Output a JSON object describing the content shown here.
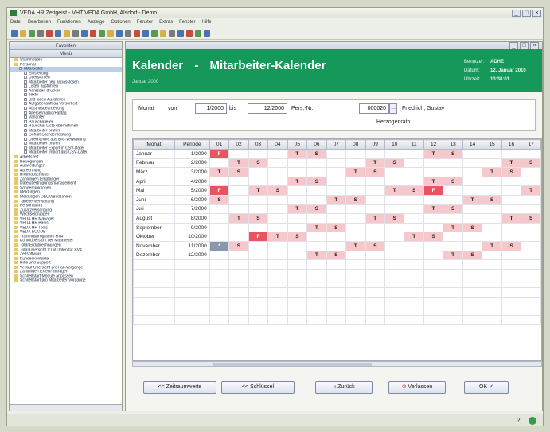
{
  "app": {
    "title": "VEDA HR Zeitgeist - VHT VEDA GmbH, Alsdorf - Demo"
  },
  "menubar": [
    "Datei",
    "Bearbeiten",
    "Funktionen",
    "Anzeige",
    "Optionen",
    "Fenster",
    "Extras",
    "Fenster",
    "Hilfe"
  ],
  "sidebar": {
    "title": "Favoriten",
    "subtitle": "Menü",
    "items": [
      "Stammdaten",
      "Personal",
      "Mitarbeiter",
      "Einstellung",
      "Übersichten",
      "Mitarbeiter neu anpasslösen",
      "Listen ausführen",
      "Adressen drucken",
      "Texte",
      "Bild laden Ausstellen",
      "Aufgabenauftrag Vorsortiert",
      "Austrittsbearbeitung",
      "Altersermäßig/Falltag",
      "Varianten",
      "Pauschalierer",
      "Pauschal-Liste übernehmen",
      "Mitarbeiter prüfen",
      "Gehalt-Sachsenleistung",
      "Übernahme aus Bild-Verwaltung",
      "Mitarbeiter prüfen",
      "Mitarbeiter Export in CSV-Datei",
      "Mitarbeiter Import aus CSV-Datei",
      "Arbeitszeit",
      "Bewegungen",
      "Auswertungen",
      "Abrechnung",
      "Bruttoabschluss",
      "Zahlungen Empfänger",
      "Dateiübertragungsmanagement",
      "Sonderfunktionen",
      "Meldungen",
      "Meldungen DEÜV/Bildzahlen",
      "Tabellenverwaltung",
      "Personalamt",
      "Zusatzversorgung",
      "Wechselgruppen",
      "VEDA HR Manager",
      "VEDA HR Basis",
      "VEDA HR Tools",
      "VEDA ECODE",
      "Trainingsprogramm HTA",
      "Kontoübersicht der Mitarbeiter",
      "Total Erdabrechnungen",
      "Total Übersicht VTM Daten für BV4",
      "Zeitsoftware",
      "Kundenkontakte",
      "Hilfe und Support",
      "Verlauf Übersicht pro Fall-Vorgänge",
      "Zahlungen Extern anfragen",
      "Schnellstart Module anpassen",
      "Schnellstart pro Mitarbeiter/Vorgänge"
    ]
  },
  "window": {
    "title": "Kalender"
  },
  "header": {
    "title": "Kalender",
    "separator": "-",
    "subtitle": "Mitarbeiter-Kalender",
    "date_small": "Januar 2000",
    "info": [
      {
        "label": "Benutzer:",
        "value": "ADHE"
      },
      {
        "label": "Datum:",
        "value": "12. Januar 2010"
      },
      {
        "label": "Uhrzeit:",
        "value": "13:38:01"
      }
    ]
  },
  "filter": {
    "monat_label": "Monat",
    "von_label": "von",
    "von_value": "1/2000",
    "bis_label": "bis",
    "bis_value": "12/2000",
    "persnr_label": "Pers.-Nr.",
    "persnr_value": "000020",
    "name": "Friedrich, Gustav",
    "ort": "Herzogenrath"
  },
  "table": {
    "headers": [
      "Monat",
      "Periode",
      "01",
      "02",
      "03",
      "04",
      "05",
      "06",
      "07",
      "08",
      "09",
      "10",
      "11",
      "12",
      "13",
      "14",
      "15",
      "16",
      "17"
    ],
    "rows": [
      {
        "month": "Januar",
        "period": "1/2000",
        "cells": [
          [
            "F",
            "f"
          ],
          [
            "",
            ""
          ],
          [
            "",
            ""
          ],
          [
            "",
            ""
          ],
          [
            "T",
            "w"
          ],
          [
            "S",
            "w"
          ],
          [
            "",
            ""
          ],
          [
            "",
            ""
          ],
          [
            "",
            ""
          ],
          [
            "",
            ""
          ],
          [
            "",
            ""
          ],
          [
            "T",
            "w"
          ],
          [
            "S",
            "w"
          ],
          [
            "",
            ""
          ],
          [
            "",
            ""
          ],
          [
            "",
            ""
          ],
          [
            "",
            ""
          ]
        ]
      },
      {
        "month": "Februar",
        "period": "2/2000",
        "cells": [
          [
            "",
            ""
          ],
          [
            "T",
            "w"
          ],
          [
            "S",
            "w"
          ],
          [
            "",
            ""
          ],
          [
            "",
            ""
          ],
          [
            "",
            ""
          ],
          [
            "",
            ""
          ],
          [
            "",
            ""
          ],
          [
            "T",
            "w"
          ],
          [
            "S",
            "w"
          ],
          [
            "",
            ""
          ],
          [
            "",
            ""
          ],
          [
            "",
            ""
          ],
          [
            "",
            ""
          ],
          [
            "",
            ""
          ],
          [
            "T",
            "w"
          ],
          [
            "S",
            "w"
          ]
        ]
      },
      {
        "month": "März",
        "period": "3/2000",
        "cells": [
          [
            "T",
            "w"
          ],
          [
            "S",
            "w"
          ],
          [
            "",
            ""
          ],
          [
            "",
            ""
          ],
          [
            "",
            ""
          ],
          [
            "",
            ""
          ],
          [
            "",
            ""
          ],
          [
            "T",
            "w"
          ],
          [
            "S",
            "w"
          ],
          [
            "",
            ""
          ],
          [
            "",
            ""
          ],
          [
            "",
            ""
          ],
          [
            "",
            ""
          ],
          [
            "",
            ""
          ],
          [
            "T",
            "w"
          ],
          [
            "S",
            "w"
          ],
          [
            "",
            ""
          ]
        ]
      },
      {
        "month": "April",
        "period": "4/2000",
        "cells": [
          [
            "",
            ""
          ],
          [
            "",
            ""
          ],
          [
            "",
            ""
          ],
          [
            "",
            ""
          ],
          [
            "T",
            "w"
          ],
          [
            "S",
            "w"
          ],
          [
            "",
            ""
          ],
          [
            "",
            ""
          ],
          [
            "",
            ""
          ],
          [
            "",
            ""
          ],
          [
            "",
            ""
          ],
          [
            "T",
            "w"
          ],
          [
            "S",
            "w"
          ],
          [
            "",
            ""
          ],
          [
            "",
            ""
          ],
          [
            "",
            ""
          ],
          [
            "",
            ""
          ]
        ]
      },
      {
        "month": "Mai",
        "period": "5/2000",
        "cells": [
          [
            "F",
            "f"
          ],
          [
            "",
            ""
          ],
          [
            "T",
            "w"
          ],
          [
            "S",
            "w"
          ],
          [
            "",
            ""
          ],
          [
            "",
            ""
          ],
          [
            "",
            ""
          ],
          [
            "",
            ""
          ],
          [
            "",
            ""
          ],
          [
            "T",
            "w"
          ],
          [
            "S",
            "w"
          ],
          [
            "F",
            "f"
          ],
          [
            "",
            ""
          ],
          [
            "",
            ""
          ],
          [
            "",
            ""
          ],
          [
            "",
            ""
          ],
          [
            "T",
            "w"
          ]
        ]
      },
      {
        "month": "Juni",
        "period": "6/2000",
        "cells": [
          [
            "S",
            "w"
          ],
          [
            "",
            ""
          ],
          [
            "",
            ""
          ],
          [
            "",
            ""
          ],
          [
            "",
            ""
          ],
          [
            "",
            ""
          ],
          [
            "T",
            "w"
          ],
          [
            "S",
            "w"
          ],
          [
            "",
            ""
          ],
          [
            "",
            ""
          ],
          [
            "",
            ""
          ],
          [
            "",
            ""
          ],
          [
            "",
            ""
          ],
          [
            "T",
            "w"
          ],
          [
            "S",
            "w"
          ],
          [
            "",
            ""
          ],
          [
            "",
            ""
          ]
        ]
      },
      {
        "month": "Juli",
        "period": "7/2000",
        "cells": [
          [
            "",
            ""
          ],
          [
            "",
            ""
          ],
          [
            "",
            ""
          ],
          [
            "",
            ""
          ],
          [
            "T",
            "w"
          ],
          [
            "S",
            "w"
          ],
          [
            "",
            ""
          ],
          [
            "",
            ""
          ],
          [
            "",
            ""
          ],
          [
            "",
            ""
          ],
          [
            "",
            ""
          ],
          [
            "T",
            "w"
          ],
          [
            "S",
            "w"
          ],
          [
            "",
            ""
          ],
          [
            "",
            ""
          ],
          [
            "",
            ""
          ],
          [
            "",
            ""
          ]
        ]
      },
      {
        "month": "August",
        "period": "8/2000",
        "cells": [
          [
            "",
            ""
          ],
          [
            "T",
            "w"
          ],
          [
            "S",
            "w"
          ],
          [
            "",
            ""
          ],
          [
            "",
            ""
          ],
          [
            "",
            ""
          ],
          [
            "",
            ""
          ],
          [
            "",
            ""
          ],
          [
            "T",
            "w"
          ],
          [
            "S",
            "w"
          ],
          [
            "",
            ""
          ],
          [
            "",
            ""
          ],
          [
            "",
            ""
          ],
          [
            "",
            ""
          ],
          [
            "",
            ""
          ],
          [
            "T",
            "w"
          ],
          [
            "S",
            "w"
          ]
        ]
      },
      {
        "month": "September",
        "period": "9/2000",
        "cells": [
          [
            "",
            ""
          ],
          [
            "",
            ""
          ],
          [
            "",
            ""
          ],
          [
            "",
            ""
          ],
          [
            "",
            ""
          ],
          [
            "T",
            "w"
          ],
          [
            "S",
            "w"
          ],
          [
            "",
            ""
          ],
          [
            "",
            ""
          ],
          [
            "",
            ""
          ],
          [
            "",
            ""
          ],
          [
            "",
            ""
          ],
          [
            "T",
            "w"
          ],
          [
            "S",
            "w"
          ],
          [
            "",
            ""
          ],
          [
            "",
            ""
          ],
          [
            "",
            ""
          ]
        ]
      },
      {
        "month": "Oktober",
        "period": "10/2000",
        "cells": [
          [
            "",
            ""
          ],
          [
            "",
            ""
          ],
          [
            "F",
            "f"
          ],
          [
            "T",
            "w"
          ],
          [
            "S",
            "w"
          ],
          [
            "",
            ""
          ],
          [
            "",
            ""
          ],
          [
            "",
            ""
          ],
          [
            "",
            ""
          ],
          [
            "",
            ""
          ],
          [
            "T",
            "w"
          ],
          [
            "S",
            "w"
          ],
          [
            "",
            ""
          ],
          [
            "",
            ""
          ],
          [
            "",
            ""
          ],
          [
            "",
            ""
          ],
          [
            "",
            ""
          ]
        ]
      },
      {
        "month": "November",
        "period": "11/2000",
        "cells": [
          [
            "*",
            "s"
          ],
          [
            "S",
            "w"
          ],
          [
            "",
            ""
          ],
          [
            "",
            ""
          ],
          [
            "",
            ""
          ],
          [
            "",
            ""
          ],
          [
            "",
            ""
          ],
          [
            "T",
            "w"
          ],
          [
            "S",
            "w"
          ],
          [
            "",
            ""
          ],
          [
            "",
            ""
          ],
          [
            "",
            ""
          ],
          [
            "",
            ""
          ],
          [
            "",
            ""
          ],
          [
            "T",
            "w"
          ],
          [
            "S",
            "w"
          ],
          [
            "",
            ""
          ]
        ]
      },
      {
        "month": "Dezember",
        "period": "12/2000",
        "cells": [
          [
            "",
            ""
          ],
          [
            "",
            ""
          ],
          [
            "",
            ""
          ],
          [
            "",
            ""
          ],
          [
            "",
            ""
          ],
          [
            "T",
            "w"
          ],
          [
            "S",
            "w"
          ],
          [
            "",
            ""
          ],
          [
            "",
            ""
          ],
          [
            "",
            ""
          ],
          [
            "",
            ""
          ],
          [
            "",
            ""
          ],
          [
            "T",
            "w"
          ],
          [
            "S",
            "w"
          ],
          [
            "",
            ""
          ],
          [
            "",
            ""
          ],
          [
            "",
            ""
          ]
        ]
      }
    ]
  },
  "buttons": {
    "zeitraum": "<< Zeitraumwerte",
    "schluessel": "<< Schlüssel",
    "zurueck": "« Zurück",
    "verlassen": "Verlassen",
    "ok": "OK"
  },
  "colors": {
    "header_green": "#16985a",
    "weekend": "#f6c8cc",
    "holiday": "#e85560",
    "selected": "#8b98ab"
  }
}
